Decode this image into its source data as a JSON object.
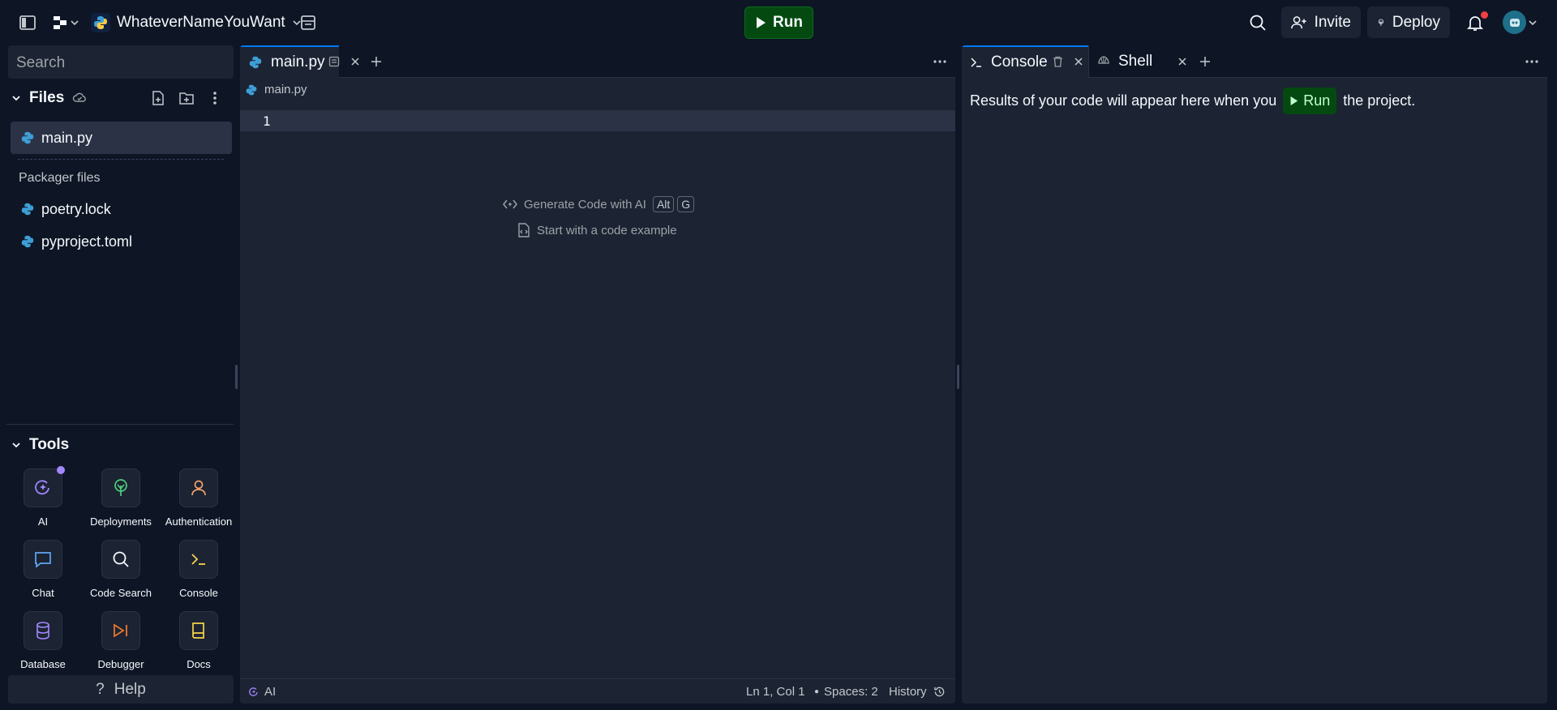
{
  "topbar": {
    "project_name": "WhateverNameYouWant",
    "run_label": "Run",
    "invite_label": "Invite",
    "deploy_label": "Deploy"
  },
  "sidebar": {
    "search_placeholder": "Search",
    "files_title": "Files",
    "files": [
      {
        "name": "main.py"
      }
    ],
    "packager_label": "Packager files",
    "packager_files": [
      {
        "name": "poetry.lock"
      },
      {
        "name": "pyproject.toml"
      }
    ],
    "tools_title": "Tools",
    "tools": [
      {
        "label": "AI",
        "icon": "ai-icon"
      },
      {
        "label": "Deployments",
        "icon": "deployments-icon"
      },
      {
        "label": "Authentication",
        "icon": "user-icon"
      },
      {
        "label": "Chat",
        "icon": "chat-icon"
      },
      {
        "label": "Code Search",
        "icon": "search-icon"
      },
      {
        "label": "Console",
        "icon": "terminal-icon"
      },
      {
        "label": "Database",
        "icon": "database-icon"
      },
      {
        "label": "Debugger",
        "icon": "debugger-icon"
      },
      {
        "label": "Docs",
        "icon": "book-icon"
      }
    ],
    "help_label": "Help"
  },
  "editor": {
    "tab_label": "main.py",
    "breadcrumb": "main.py",
    "line_number": "1",
    "hint_generate": "Generate Code with AI",
    "hint_key_1": "Alt",
    "hint_key_2": "G",
    "hint_example": "Start with a code example",
    "status": {
      "ai_label": "AI",
      "position": "Ln 1, Col 1",
      "spaces": "Spaces: 2",
      "history": "History"
    }
  },
  "console": {
    "tab_console": "Console",
    "tab_shell": "Shell",
    "message_before": "Results of your code will appear here when you",
    "run_label": "Run",
    "message_after": "the project."
  },
  "colors": {
    "background": "#0e1525",
    "panel": "#1c2333",
    "run_green": "#044a10",
    "accent_blue": "#0079f2",
    "notification_red": "#f23f42",
    "ai_purple": "#a287ff"
  }
}
